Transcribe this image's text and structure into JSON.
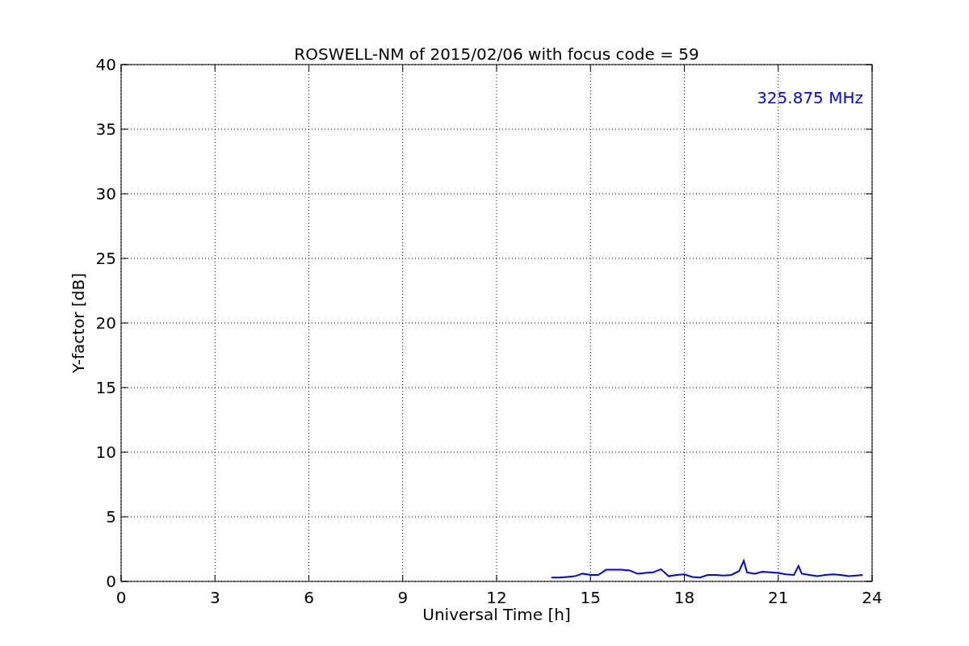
{
  "figure": {
    "chart_data": {
      "type": "line",
      "title": "ROSWELL-NM of 2015/02/06 with focus code = 59",
      "xlabel": "Universal Time [h]",
      "ylabel": "Y-factor [dB]",
      "x": [
        13.75,
        14.0,
        14.25,
        14.5,
        14.75,
        15.0,
        15.25,
        15.5,
        15.75,
        16.0,
        16.25,
        16.5,
        16.75,
        17.0,
        17.25,
        17.5,
        17.75,
        18.0,
        18.25,
        18.5,
        18.75,
        19.0,
        19.25,
        19.5,
        19.75,
        19.9,
        20.0,
        20.25,
        20.5,
        20.75,
        21.0,
        21.25,
        21.5,
        21.65,
        21.75,
        22.0,
        22.25,
        22.5,
        22.75,
        23.0,
        23.25,
        23.5,
        23.7
      ],
      "series": [
        {
          "name": "325.875 MHz",
          "color": "#0000ff",
          "values": [
            0.3,
            0.3,
            0.35,
            0.4,
            0.6,
            0.5,
            0.5,
            0.9,
            0.9,
            0.9,
            0.85,
            0.6,
            0.65,
            0.7,
            0.95,
            0.4,
            0.5,
            0.55,
            0.35,
            0.3,
            0.5,
            0.5,
            0.45,
            0.5,
            0.8,
            1.6,
            0.7,
            0.6,
            0.75,
            0.7,
            0.65,
            0.55,
            0.5,
            1.2,
            0.6,
            0.5,
            0.4,
            0.5,
            0.55,
            0.5,
            0.4,
            0.45,
            0.5
          ]
        }
      ],
      "xlim": [
        0,
        24
      ],
      "ylim": [
        0,
        40
      ],
      "xticks": [
        0,
        3,
        6,
        9,
        12,
        15,
        18,
        21,
        24
      ],
      "yticks": [
        0,
        5,
        10,
        15,
        20,
        25,
        30,
        35,
        40
      ],
      "grid": true
    }
  }
}
